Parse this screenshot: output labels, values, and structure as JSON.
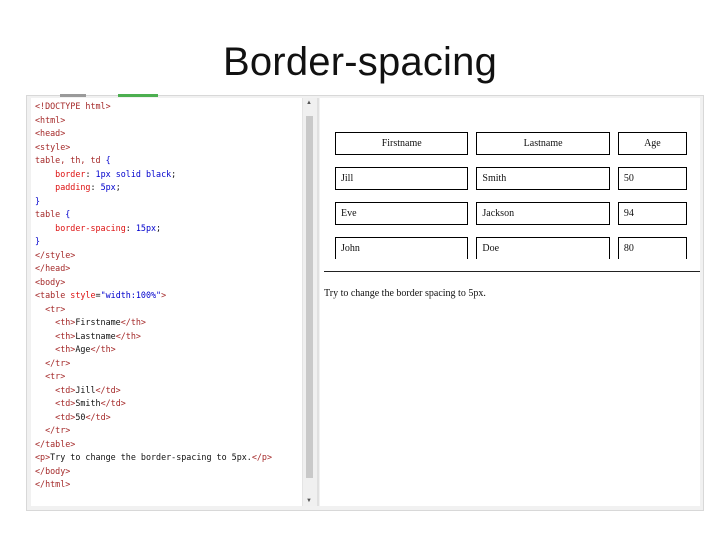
{
  "slide": {
    "title": "Border-spacing"
  },
  "code": {
    "lines": [
      [
        [
          "tag",
          "<!DOCTYPE html>"
        ]
      ],
      [
        [
          "tag",
          "<html>"
        ]
      ],
      [
        [
          "tag",
          "<head>"
        ]
      ],
      [
        [
          "tag",
          "<style>"
        ]
      ],
      [
        [
          "sel",
          "table, th, td "
        ],
        [
          "br",
          "{"
        ]
      ],
      [
        [
          "txt",
          "    "
        ],
        [
          "prop",
          "border"
        ],
        [
          "txt",
          ": "
        ],
        [
          "val",
          "1px solid black"
        ],
        [
          "txt",
          ";"
        ]
      ],
      [
        [
          "txt",
          "    "
        ],
        [
          "prop",
          "padding"
        ],
        [
          "txt",
          ": "
        ],
        [
          "val",
          "5px"
        ],
        [
          "txt",
          ";"
        ]
      ],
      [
        [
          "br",
          "}"
        ]
      ],
      [
        [
          "sel",
          "table "
        ],
        [
          "br",
          "{"
        ]
      ],
      [
        [
          "txt",
          "    "
        ],
        [
          "prop",
          "border-spacing"
        ],
        [
          "txt",
          ": "
        ],
        [
          "val",
          "15px"
        ],
        [
          "txt",
          ";"
        ]
      ],
      [
        [
          "br",
          "}"
        ]
      ],
      [
        [
          "tag",
          "</style>"
        ]
      ],
      [
        [
          "tag",
          "</head>"
        ]
      ],
      [
        [
          "tag",
          "<body>"
        ]
      ],
      [
        [
          "tag",
          "<table "
        ],
        [
          "attr",
          "style"
        ],
        [
          "txt",
          "="
        ],
        [
          "str",
          "\"width:100%\""
        ],
        [
          "tag",
          ">"
        ]
      ],
      [
        [
          "txt",
          "  "
        ],
        [
          "tag",
          "<tr>"
        ]
      ],
      [
        [
          "txt",
          "    "
        ],
        [
          "tag",
          "<th>"
        ],
        [
          "txt",
          "Firstname"
        ],
        [
          "tag",
          "</th>"
        ]
      ],
      [
        [
          "txt",
          "    "
        ],
        [
          "tag",
          "<th>"
        ],
        [
          "txt",
          "Lastname"
        ],
        [
          "tag",
          "</th>"
        ]
      ],
      [
        [
          "txt",
          "    "
        ],
        [
          "tag",
          "<th>"
        ],
        [
          "txt",
          "Age"
        ],
        [
          "tag",
          "</th>"
        ]
      ],
      [
        [
          "txt",
          "  "
        ],
        [
          "tag",
          "</tr>"
        ]
      ],
      [
        [
          "txt",
          "  "
        ],
        [
          "tag",
          "<tr>"
        ]
      ],
      [
        [
          "txt",
          "    "
        ],
        [
          "tag",
          "<td>"
        ],
        [
          "txt",
          "Jill"
        ],
        [
          "tag",
          "</td>"
        ]
      ],
      [
        [
          "txt",
          "    "
        ],
        [
          "tag",
          "<td>"
        ],
        [
          "txt",
          "Smith"
        ],
        [
          "tag",
          "</td>"
        ]
      ],
      [
        [
          "txt",
          "    "
        ],
        [
          "tag",
          "<td>"
        ],
        [
          "txt",
          "50"
        ],
        [
          "tag",
          "</td>"
        ]
      ],
      [
        [
          "txt",
          "  "
        ],
        [
          "tag",
          "</tr>"
        ]
      ],
      [
        [
          "tag",
          "</table>"
        ]
      ],
      [
        [
          "tag",
          "<p>"
        ],
        [
          "txt",
          "Try to change the border-spacing to 5px."
        ],
        [
          "tag",
          "</p>"
        ]
      ],
      [
        [
          "tag",
          "</body>"
        ]
      ],
      [
        [
          "tag",
          "</html>"
        ]
      ]
    ]
  },
  "result": {
    "headers": [
      "Firstname",
      "Lastname",
      "Age"
    ],
    "rows": [
      [
        "Jill",
        "Smith",
        "50"
      ],
      [
        "Eve",
        "Jackson",
        "94"
      ],
      [
        "John",
        "Doe",
        "80"
      ]
    ],
    "note": "Try to change the border spacing to 5px."
  }
}
